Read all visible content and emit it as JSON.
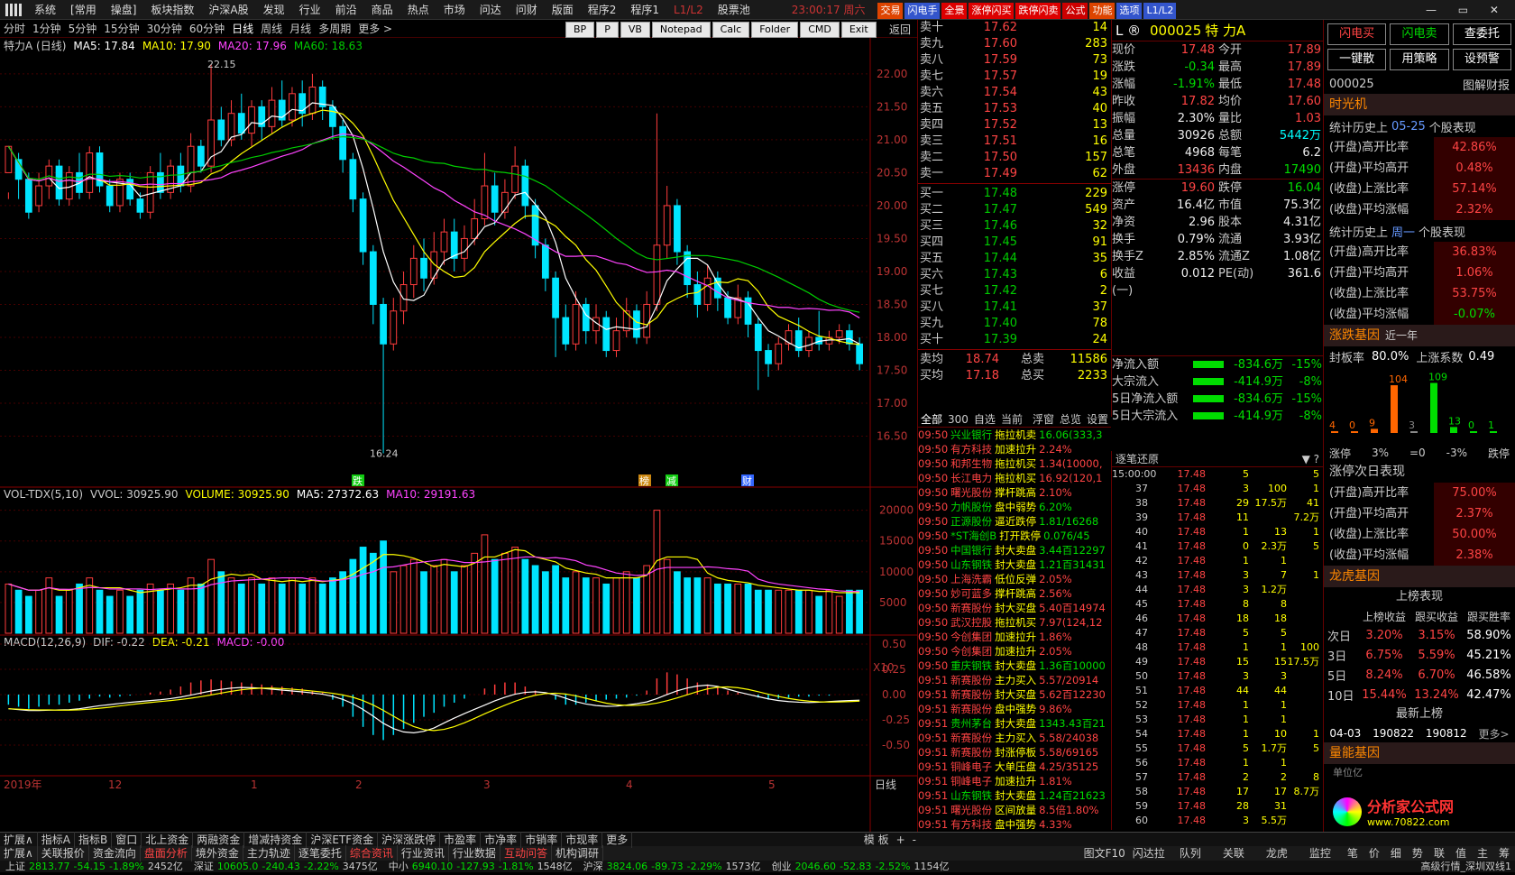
{
  "menu": {
    "items": [
      "系统",
      "[常用",
      "操盘]",
      "板块指数",
      "沪深A股",
      "发现",
      "行业",
      "前沿",
      "商品",
      "热点",
      "市场",
      "问达",
      "问财",
      "版面",
      "程序2",
      "程序1",
      "L1/L2",
      "股票池"
    ],
    "time": "23:00:17 周六",
    "tags": [
      "交易",
      "闪电手",
      "全景",
      "涨停闪买",
      "跌停闪卖",
      "公式",
      "功能",
      "选项",
      "L1/L2"
    ]
  },
  "timeframes": [
    "分时",
    "1分钟",
    "5分钟",
    "15分钟",
    "30分钟",
    "60分钟",
    "日线",
    "周线",
    "月线",
    "多周期",
    "更多 >"
  ],
  "toolbuttons": [
    "BP",
    "P",
    "VB",
    "Notepad",
    "Calc",
    "Folder",
    "CMD",
    "Exit"
  ],
  "back": "返回",
  "chart": {
    "title": "特力A (日线)",
    "ma5": "MA5: 17.84",
    "ma10": "MA10: 17.90",
    "ma20": "MA20: 17.96",
    "ma60": "MA60: 18.63",
    "high_label": "22.15",
    "low_label": "16.24",
    "price_ticks": [
      "22.00",
      "21.50",
      "21.00",
      "20.50",
      "20.00",
      "19.50",
      "19.00",
      "18.50",
      "18.00",
      "17.50",
      "17.00",
      "16.50"
    ],
    "markers": [
      "跌",
      "榜",
      "减",
      "财"
    ]
  },
  "vol": {
    "title": "VOL-TDX(5,10)",
    "vvol": "VVOL: 30925.90",
    "volume": "VOLUME: 30925.90",
    "ma5": "MA5: 27372.63",
    "ma10": "MA10: 29191.63",
    "ticks": [
      "20000",
      "15000",
      "10000",
      "5000"
    ],
    "unit": "X10"
  },
  "macd": {
    "title": "MACD(12,26,9)",
    "dif": "DIF: -0.22",
    "dea": "DEA: -0.21",
    "macd": "MACD: -0.00",
    "ticks": [
      "0.50",
      "0.25",
      "0.00",
      "-0.25",
      "-0.50"
    ]
  },
  "xaxis": {
    "labels": [
      "2019年",
      "12",
      "1",
      "2",
      "3",
      "4",
      "5"
    ],
    "period": "日线"
  },
  "orderbook": {
    "sell": [
      [
        "卖十",
        "17.62",
        "14"
      ],
      [
        "卖九",
        "17.60",
        "283"
      ],
      [
        "卖八",
        "17.59",
        "73"
      ],
      [
        "卖七",
        "17.57",
        "19"
      ],
      [
        "卖六",
        "17.54",
        "43"
      ],
      [
        "卖五",
        "17.53",
        "40"
      ],
      [
        "卖四",
        "17.52",
        "13"
      ],
      [
        "卖三",
        "17.51",
        "16"
      ],
      [
        "卖二",
        "17.50",
        "157"
      ],
      [
        "卖一",
        "17.49",
        "62"
      ]
    ],
    "buy": [
      [
        "买一",
        "17.48",
        "229"
      ],
      [
        "买二",
        "17.47",
        "549"
      ],
      [
        "买三",
        "17.46",
        "32"
      ],
      [
        "买四",
        "17.45",
        "91"
      ],
      [
        "买五",
        "17.44",
        "35"
      ],
      [
        "买六",
        "17.43",
        "6"
      ],
      [
        "买七",
        "17.42",
        "2"
      ],
      [
        "买八",
        "17.41",
        "37"
      ],
      [
        "买九",
        "17.40",
        "78"
      ],
      [
        "买十",
        "17.39",
        "24"
      ]
    ],
    "avg": [
      [
        "卖均",
        "18.74",
        "总卖",
        "11586"
      ],
      [
        "买均",
        "17.18",
        "总买",
        "2233"
      ]
    ]
  },
  "quote": {
    "code": "000025",
    "name": "特 力A",
    "rows": [
      [
        "现价",
        "17.48",
        "今开",
        "17.89"
      ],
      [
        "涨跌",
        "-0.34",
        "最高",
        "17.89"
      ],
      [
        "涨幅",
        "-1.91%",
        "最低",
        "17.48"
      ],
      [
        "昨收",
        "17.82",
        "均价",
        "17.60"
      ],
      [
        "振幅",
        "2.30%",
        "量比",
        "1.03"
      ],
      [
        "总量",
        "30926",
        "总额",
        "5442万"
      ],
      [
        "总笔",
        "4968",
        "每笔",
        "6.2"
      ],
      [
        "外盘",
        "13436",
        "内盘",
        "17490"
      ],
      [
        "涨停",
        "19.60",
        "跌停",
        "16.04"
      ],
      [
        "资产",
        "16.4亿",
        "市值",
        "75.3亿"
      ],
      [
        "净资",
        "2.96",
        "股本",
        "4.31亿"
      ],
      [
        "换手",
        "0.79%",
        "流通",
        "3.93亿"
      ],
      [
        "换手Z",
        "2.85%",
        "流通Z",
        "1.08亿"
      ],
      [
        "收益(一)",
        "0.012",
        "PE(动)",
        "361.6"
      ]
    ]
  },
  "flow": [
    [
      "净流入额",
      "-834.6万",
      "-15%"
    ],
    [
      "大宗流入",
      "-414.9万",
      "-8%"
    ],
    [
      "5日净流入额",
      "-834.6万",
      "-15%"
    ],
    [
      "5日大宗流入",
      "-414.9万",
      "-8%"
    ]
  ],
  "ticker_tabs": [
    "全部",
    "300",
    "自选",
    "当前",
    "浮窗",
    "总览",
    "设置"
  ],
  "ticker": [
    [
      "09:50",
      "兴业银行",
      "拖拉机卖",
      "16.06(333,3"
    ],
    [
      "09:50",
      "有方科技",
      "加速拉升",
      "2.24%"
    ],
    [
      "09:50",
      "和邦生物",
      "拖拉机买",
      "1.34(10000,"
    ],
    [
      "09:50",
      "长江电力",
      "拖拉机买",
      "16.92(120,1"
    ],
    [
      "09:50",
      "曙光股份",
      "撑杆跳高",
      "2.10%"
    ],
    [
      "09:50",
      "力帆股份",
      "盘中弱势",
      "6.20%"
    ],
    [
      "09:50",
      "正源股份",
      "逼近跌停",
      "1.81/16268"
    ],
    [
      "09:50",
      "*ST海创B",
      "打开跌停",
      "0.076/45"
    ],
    [
      "09:50",
      "中国银行",
      "封大卖盘",
      "3.44百12297"
    ],
    [
      "09:50",
      "山东钢铁",
      "封大卖盘",
      "1.21百31431"
    ],
    [
      "09:50",
      "上海洗霸",
      "低位反弹",
      "2.05%"
    ],
    [
      "09:50",
      "妙可蓝多",
      "撑杆跳高",
      "2.56%"
    ],
    [
      "09:50",
      "新赛股份",
      "封大买盘",
      "5.40百14974"
    ],
    [
      "09:50",
      "武汉控股",
      "拖拉机买",
      "7.97(124,12"
    ],
    [
      "09:50",
      "今创集团",
      "加速拉升",
      "1.86%"
    ],
    [
      "09:50",
      "今创集团",
      "加速拉升",
      "2.05%"
    ],
    [
      "09:50",
      "重庆钢铁",
      "封大卖盘",
      "1.36百10000"
    ],
    [
      "09:51",
      "新赛股份",
      "主力买入",
      "5.57/20914"
    ],
    [
      "09:51",
      "新赛股份",
      "封大买盘",
      "5.62百12230"
    ],
    [
      "09:51",
      "新赛股份",
      "盘中强势",
      "9.86%"
    ],
    [
      "09:51",
      "贵州茅台",
      "封大卖盘",
      "1343.43百21"
    ],
    [
      "09:51",
      "新赛股份",
      "主力买入",
      "5.58/24038"
    ],
    [
      "09:51",
      "新赛股份",
      "封涨停板",
      "5.58/69165"
    ],
    [
      "09:51",
      "铜峰电子",
      "大单压盘",
      "4.25/35125"
    ],
    [
      "09:51",
      "铜峰电子",
      "加速拉升",
      "1.81%"
    ],
    [
      "09:51",
      "山东钢铁",
      "封大卖盘",
      "1.24百21623"
    ],
    [
      "09:51",
      "曙光股份",
      "区间放量",
      "8.5倍1.80%"
    ],
    [
      "09:51",
      "有方科技",
      "盘中强势",
      "4.33%"
    ]
  ],
  "trades_header": "逐笔还原",
  "trades": [
    [
      "15:00:00",
      "17.48",
      "5",
      "",
      "5"
    ],
    [
      "37",
      "17.48",
      "3",
      "100",
      "1"
    ],
    [
      "38",
      "17.48",
      "29",
      "17.5万",
      "41"
    ],
    [
      "39",
      "17.48",
      "11",
      "",
      "7.2万"
    ],
    [
      "40",
      "17.48",
      "1",
      "13",
      "1"
    ],
    [
      "41",
      "17.48",
      "0",
      "2.3万",
      "5"
    ],
    [
      "42",
      "17.48",
      "1",
      "1",
      ""
    ],
    [
      "43",
      "17.48",
      "3",
      "7",
      "1"
    ],
    [
      "44",
      "17.48",
      "3",
      "1.2万",
      ""
    ],
    [
      "45",
      "17.48",
      "8",
      "8",
      ""
    ],
    [
      "46",
      "17.48",
      "18",
      "18",
      ""
    ],
    [
      "47",
      "17.48",
      "5",
      "5",
      ""
    ],
    [
      "48",
      "17.48",
      "1",
      "1",
      "100"
    ],
    [
      "49",
      "17.48",
      "15",
      "15",
      "17.5万"
    ],
    [
      "50",
      "17.48",
      "3",
      "3",
      ""
    ],
    [
      "51",
      "17.48",
      "44",
      "44",
      ""
    ],
    [
      "52",
      "17.48",
      "1",
      "1",
      ""
    ],
    [
      "53",
      "17.48",
      "1",
      "1",
      ""
    ],
    [
      "54",
      "17.48",
      "1",
      "10",
      "1"
    ],
    [
      "55",
      "17.48",
      "5",
      "1.7万",
      "5"
    ],
    [
      "56",
      "17.48",
      "1",
      "1",
      ""
    ],
    [
      "57",
      "17.48",
      "2",
      "2",
      "8"
    ],
    [
      "58",
      "17.48",
      "17",
      "17",
      "8.7万"
    ],
    [
      "59",
      "17.48",
      "28",
      "31",
      ""
    ],
    [
      "60",
      "17.48",
      "3",
      "5.5万",
      ""
    ]
  ],
  "right": {
    "btns": [
      "闪电买",
      "闪电卖",
      "查委托",
      "一键散",
      "用策略",
      "设预警"
    ],
    "code": "000025",
    "link": "图解财报",
    "tm": "时光机",
    "stat1_pre": "统计历史上",
    "stat1_date": "05-25",
    "stat1_post": "个股表现",
    "stat1": [
      [
        "(开盘)高开比率",
        "42.86%"
      ],
      [
        "(开盘)平均高开",
        "0.48%"
      ],
      [
        "(收盘)上涨比率",
        "57.14%"
      ],
      [
        "(收盘)平均涨幅",
        "2.32%"
      ]
    ],
    "stat2_pre": "统计历史上",
    "stat2_date": "周一",
    "stat2_post": "个股表现",
    "stat2": [
      [
        "(开盘)高开比率",
        "36.83%"
      ],
      [
        "(开盘)平均高开",
        "1.06%"
      ],
      [
        "(收盘)上涨比率",
        "53.75%"
      ],
      [
        "(收盘)平均涨幅",
        "-0.07%"
      ]
    ],
    "gene": "涨跌基因",
    "gene_sub": "近一年",
    "seal": "封板率",
    "seal_v": "80.0%",
    "up": "上涨系数",
    "up_v": "0.49",
    "hist": [
      4,
      0,
      9,
      104,
      3,
      109,
      13,
      0,
      1
    ],
    "hist_axis": [
      "涨停",
      "3%",
      "=0",
      "-3%",
      "跌停"
    ],
    "next": "涨停次日表现",
    "stat3": [
      [
        "(开盘)高开比率",
        "75.00%"
      ],
      [
        "(开盘)平均高开",
        "2.37%"
      ],
      [
        "(收盘)上涨比率",
        "50.00%"
      ],
      [
        "(收盘)平均涨幅",
        "2.38%"
      ]
    ],
    "lhb": "龙虎基因",
    "lhb_perf": "上榜表现",
    "lhb_cols": [
      "上榜收益",
      "跟买收益",
      "跟买胜率"
    ],
    "lhb_rows": [
      [
        "次日",
        "3.20%",
        "3.15%",
        "58.90%"
      ],
      [
        "3日",
        "6.75%",
        "5.59%",
        "45.21%"
      ],
      [
        "5日",
        "8.24%",
        "6.70%",
        "46.58%"
      ],
      [
        "10日",
        "15.44%",
        "13.24%",
        "42.47%"
      ]
    ],
    "latest": "最新上榜",
    "latest_row": [
      "04-03",
      "190822",
      "190812",
      "更多>"
    ],
    "qn": "量能基因",
    "unit": "单位亿",
    "logo": "分析家公式网",
    "logo_url": "www.70822.com"
  },
  "bottom": {
    "row1": [
      "扩展∧",
      "指标A",
      "指标B",
      "窗口",
      "北上资金",
      "两融资金",
      "增减持资金",
      "沪深ETF资金",
      "沪深涨跌停",
      "市盈率",
      "市净率",
      "市销率",
      "市现率",
      "更多"
    ],
    "row2": [
      "扩展∧",
      "关联报价",
      "资金流向",
      "盘面分析",
      "境外资金",
      "主力轨迹",
      "逐笔委托",
      "综合资讯",
      "行业资讯",
      "行业数据",
      "互动问答",
      "机构调研"
    ],
    "tabs": [
      "模 板",
      "+",
      "-"
    ],
    "tabs2": [
      "图文F10",
      "闪达拉"
    ],
    "lower_tabs": [
      "队列",
      "关联",
      "龙虎",
      "监控"
    ],
    "lower_tabs2": [
      "笔",
      "价",
      "细",
      "势",
      "联",
      "值",
      "主",
      "筹"
    ],
    "idx": [
      [
        "上证",
        "2813.77",
        "-54.15",
        "-1.89%",
        "2452亿"
      ],
      [
        "深证",
        "10605.0",
        "-240.43",
        "-2.22%",
        "3475亿"
      ],
      [
        "中小",
        "6940.10",
        "-127.93",
        "-1.81%",
        "1548亿"
      ],
      [
        "沪深",
        "3824.06",
        "-89.73",
        "-2.29%",
        "1573亿"
      ],
      [
        "创业",
        "2046.60",
        "-52.83",
        "-2.52%",
        "1154亿"
      ]
    ],
    "status": "高级行情_深圳双线1"
  },
  "colors": {
    "up": "#ff3c3c",
    "down": "#00e5ff",
    "ma5": "#ffffff",
    "ma10": "#ffff00",
    "ma20": "#ff44ff",
    "ma60": "#00cc00"
  },
  "candles": [
    [
      20.5,
      20.9,
      20.2,
      20.1
    ],
    [
      20.7,
      20.4,
      20.8,
      20.1
    ],
    [
      20.4,
      19.9,
      20.5,
      19.8
    ],
    [
      20.0,
      20.3,
      20.5,
      19.9
    ],
    [
      20.3,
      20.6,
      20.7,
      20.1
    ],
    [
      20.6,
      20.1,
      20.7,
      20.0
    ],
    [
      20.1,
      20.5,
      20.6,
      20.0
    ],
    [
      20.5,
      20.2,
      20.8,
      20.1
    ],
    [
      20.2,
      20.8,
      20.9,
      20.1
    ],
    [
      20.8,
      20.3,
      20.9,
      20.2
    ],
    [
      20.3,
      20.0,
      20.4,
      19.9
    ],
    [
      20.0,
      20.4,
      20.5,
      19.9
    ],
    [
      20.4,
      20.1,
      20.5,
      20.0
    ],
    [
      20.1,
      19.9,
      20.2,
      19.8
    ],
    [
      19.9,
      20.5,
      20.6,
      19.8
    ],
    [
      20.5,
      20.2,
      20.8,
      20.1
    ],
    [
      20.2,
      20.6,
      20.7,
      20.1
    ],
    [
      20.6,
      20.3,
      20.8,
      20.2
    ],
    [
      20.3,
      20.9,
      21.1,
      20.2
    ],
    [
      20.9,
      20.6,
      21.0,
      20.5
    ],
    [
      20.6,
      21.3,
      22.15,
      20.5
    ],
    [
      21.3,
      21.0,
      21.5,
      20.9
    ],
    [
      21.0,
      21.4,
      21.6,
      20.9
    ],
    [
      21.4,
      21.1,
      21.7,
      21.0
    ],
    [
      21.1,
      21.5,
      21.6,
      20.9
    ],
    [
      21.5,
      21.2,
      21.6,
      21.0
    ],
    [
      21.2,
      21.6,
      21.8,
      21.1
    ],
    [
      21.6,
      21.3,
      21.9,
      21.2
    ],
    [
      21.3,
      21.7,
      21.8,
      21.2
    ],
    [
      21.7,
      21.4,
      21.9,
      21.2
    ],
    [
      21.4,
      21.8,
      22.0,
      21.3
    ],
    [
      21.8,
      21.5,
      21.9,
      21.3
    ],
    [
      21.5,
      21.2,
      21.6,
      21.0
    ],
    [
      21.2,
      20.7,
      21.3,
      20.5
    ],
    [
      20.7,
      20.1,
      20.8,
      19.9
    ],
    [
      20.1,
      19.3,
      20.2,
      19.1
    ],
    [
      19.3,
      18.5,
      19.4,
      18.2
    ],
    [
      18.5,
      17.9,
      18.6,
      16.24
    ],
    [
      17.9,
      18.4,
      18.6,
      17.8
    ],
    [
      18.4,
      18.8,
      19.0,
      18.2
    ],
    [
      18.8,
      19.2,
      19.4,
      18.6
    ],
    [
      19.2,
      18.9,
      19.5,
      18.7
    ],
    [
      18.9,
      19.3,
      19.6,
      18.8
    ],
    [
      19.3,
      19.6,
      19.8,
      19.1
    ],
    [
      19.6,
      19.2,
      19.8,
      19.0
    ],
    [
      19.2,
      19.5,
      19.7,
      19.0
    ],
    [
      19.5,
      19.8,
      20.1,
      19.4
    ],
    [
      19.8,
      20.3,
      20.8,
      19.7
    ],
    [
      20.3,
      19.9,
      20.5,
      19.7
    ],
    [
      19.9,
      20.2,
      20.4,
      19.8
    ],
    [
      20.2,
      20.6,
      20.9,
      20.1
    ],
    [
      20.6,
      20.0,
      20.7,
      19.8
    ],
    [
      20.0,
      19.4,
      20.1,
      19.2
    ],
    [
      19.4,
      18.9,
      19.5,
      18.7
    ],
    [
      18.9,
      18.3,
      19.0,
      17.7
    ],
    [
      18.3,
      17.9,
      18.5,
      17.8
    ],
    [
      17.9,
      18.5,
      18.7,
      17.8
    ],
    [
      18.5,
      18.1,
      18.6,
      17.9
    ],
    [
      18.1,
      18.3,
      18.5,
      17.9
    ],
    [
      18.3,
      17.8,
      18.4,
      17.7
    ],
    [
      17.8,
      18.1,
      18.3,
      17.7
    ],
    [
      18.1,
      18.4,
      18.6,
      18.0
    ],
    [
      18.4,
      18.0,
      18.5,
      17.9
    ],
    [
      18.0,
      18.5,
      18.7,
      17.9
    ],
    [
      18.5,
      19.4,
      21.4,
      18.4
    ],
    [
      19.4,
      20.0,
      20.3,
      19.2
    ],
    [
      20.0,
      19.3,
      20.1,
      19.1
    ],
    [
      19.3,
      18.8,
      19.4,
      18.6
    ],
    [
      18.8,
      18.5,
      19.0,
      18.3
    ],
    [
      18.5,
      18.9,
      19.1,
      18.4
    ],
    [
      18.9,
      18.6,
      19.0,
      18.4
    ],
    [
      18.6,
      18.3,
      18.7,
      18.2
    ],
    [
      18.3,
      18.6,
      18.8,
      18.2
    ],
    [
      18.6,
      18.2,
      18.7,
      18.0
    ],
    [
      18.2,
      17.8,
      18.3,
      17.2
    ],
    [
      17.8,
      17.6,
      17.9,
      17.4
    ],
    [
      17.6,
      17.9,
      18.0,
      17.5
    ],
    [
      17.9,
      18.1,
      18.2,
      17.8
    ],
    [
      18.1,
      17.8,
      18.3,
      17.7
    ],
    [
      17.8,
      18.0,
      18.1,
      17.7
    ],
    [
      18.0,
      17.9,
      18.4,
      17.8
    ],
    [
      17.9,
      18.0,
      18.1,
      17.8
    ],
    [
      18.0,
      18.1,
      18.2,
      17.9
    ],
    [
      18.1,
      17.9,
      18.2,
      17.8
    ],
    [
      17.9,
      17.6,
      18.0,
      17.5
    ]
  ],
  "volumes": [
    8,
    7,
    6,
    7,
    9,
    6,
    7,
    8,
    9,
    7,
    6,
    7,
    6,
    7,
    8,
    7,
    8,
    7,
    9,
    8,
    12,
    10,
    9,
    8,
    9,
    8,
    9,
    8,
    9,
    8,
    9,
    8,
    9,
    10,
    12,
    14,
    13,
    15,
    10,
    11,
    12,
    10,
    11,
    12,
    10,
    11,
    13,
    16,
    12,
    13,
    14,
    12,
    11,
    10,
    11,
    9,
    10,
    9,
    9,
    8,
    9,
    10,
    9,
    11,
    20,
    12,
    10,
    9,
    9,
    9,
    8,
    8,
    8,
    8,
    7,
    7,
    7,
    7,
    7,
    7,
    6,
    7,
    6,
    7,
    7
  ],
  "macdbars": [
    -0.1,
    -0.12,
    -0.14,
    -0.12,
    -0.1,
    -0.1,
    -0.08,
    -0.06,
    -0.04,
    -0.02,
    -0.03,
    -0.02,
    -0.01,
    0.0,
    0.02,
    0.03,
    0.05,
    0.08,
    0.12,
    0.14,
    0.15,
    0.14,
    0.13,
    0.12,
    0.11,
    0.1,
    0.09,
    0.08,
    0.07,
    0.06,
    0.04,
    0.02,
    -0.05,
    -0.12,
    -0.22,
    -0.32,
    -0.4,
    -0.45,
    -0.4,
    -0.34,
    -0.28,
    -0.22,
    -0.18,
    -0.12,
    -0.08,
    -0.04,
    0.0,
    0.06,
    0.1,
    0.12,
    0.12,
    0.08,
    0.04,
    0.0,
    -0.05,
    -0.1,
    -0.1,
    -0.08,
    -0.06,
    -0.05,
    -0.04,
    -0.03,
    -0.01,
    0.04,
    0.16,
    0.22,
    0.2,
    0.16,
    0.12,
    0.1,
    0.07,
    0.04,
    0.02,
    0.0,
    -0.03,
    -0.05,
    -0.04,
    -0.03,
    -0.02,
    -0.02,
    -0.01,
    -0.01,
    0.0,
    0.0,
    -0.0
  ]
}
